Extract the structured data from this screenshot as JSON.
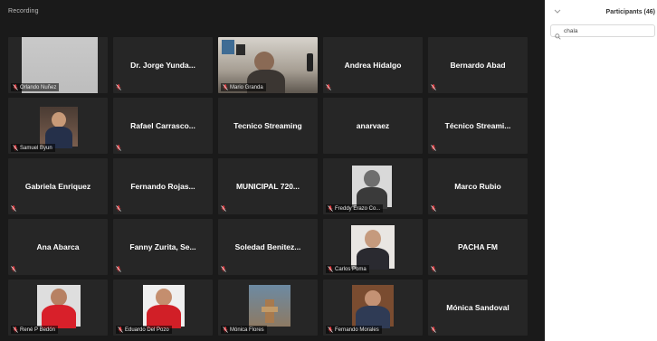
{
  "recording_label": "Recording",
  "panel": {
    "title": "Participants (46)",
    "search_value": "chala"
  },
  "tiles": [
    {
      "name": "Orlando Nuñez",
      "kind": "video"
    },
    {
      "name": "Dr. Jorge Yunda...",
      "kind": "name"
    },
    {
      "name": "Mario Granda",
      "kind": "video"
    },
    {
      "name": "Andrea Hidalgo",
      "kind": "name"
    },
    {
      "name": "Bernardo Abad",
      "kind": "name"
    },
    {
      "name": "Samuel Byun",
      "kind": "video"
    },
    {
      "name": "Rafael Carrasco...",
      "kind": "name"
    },
    {
      "name": "Tecnico Streaming",
      "kind": "name"
    },
    {
      "name": "anarvaez",
      "kind": "name"
    },
    {
      "name": "Técnico Streami...",
      "kind": "name"
    },
    {
      "name": "Gabriela Enriquez",
      "kind": "name"
    },
    {
      "name": "Fernando Rojas...",
      "kind": "name"
    },
    {
      "name": "MUNICIPAL 720...",
      "kind": "name"
    },
    {
      "name": "Freddy Erazo Co...",
      "kind": "video"
    },
    {
      "name": "Marco Rubio",
      "kind": "name"
    },
    {
      "name": "Ana Abarca",
      "kind": "name"
    },
    {
      "name": "Fanny Zurita, Se...",
      "kind": "name"
    },
    {
      "name": "Soledad Benitez...",
      "kind": "name"
    },
    {
      "name": "Carlos Poma",
      "kind": "video"
    },
    {
      "name": "PACHA FM",
      "kind": "name"
    },
    {
      "name": "René P Bedón",
      "kind": "video"
    },
    {
      "name": "Eduardo Del Pozo",
      "kind": "video"
    },
    {
      "name": "Mónica Flores",
      "kind": "video"
    },
    {
      "name": "Fernando Morales",
      "kind": "video"
    },
    {
      "name": "Mónica Sandoval",
      "kind": "name"
    }
  ],
  "colors": {
    "gallery_bg": "#1a1a1a",
    "tile_bg": "#262626",
    "mute_red": "#e0393e"
  },
  "icons": {
    "mute": "microphone-muted-icon",
    "search": "search-icon",
    "collapse": "chevron-down-icon"
  }
}
